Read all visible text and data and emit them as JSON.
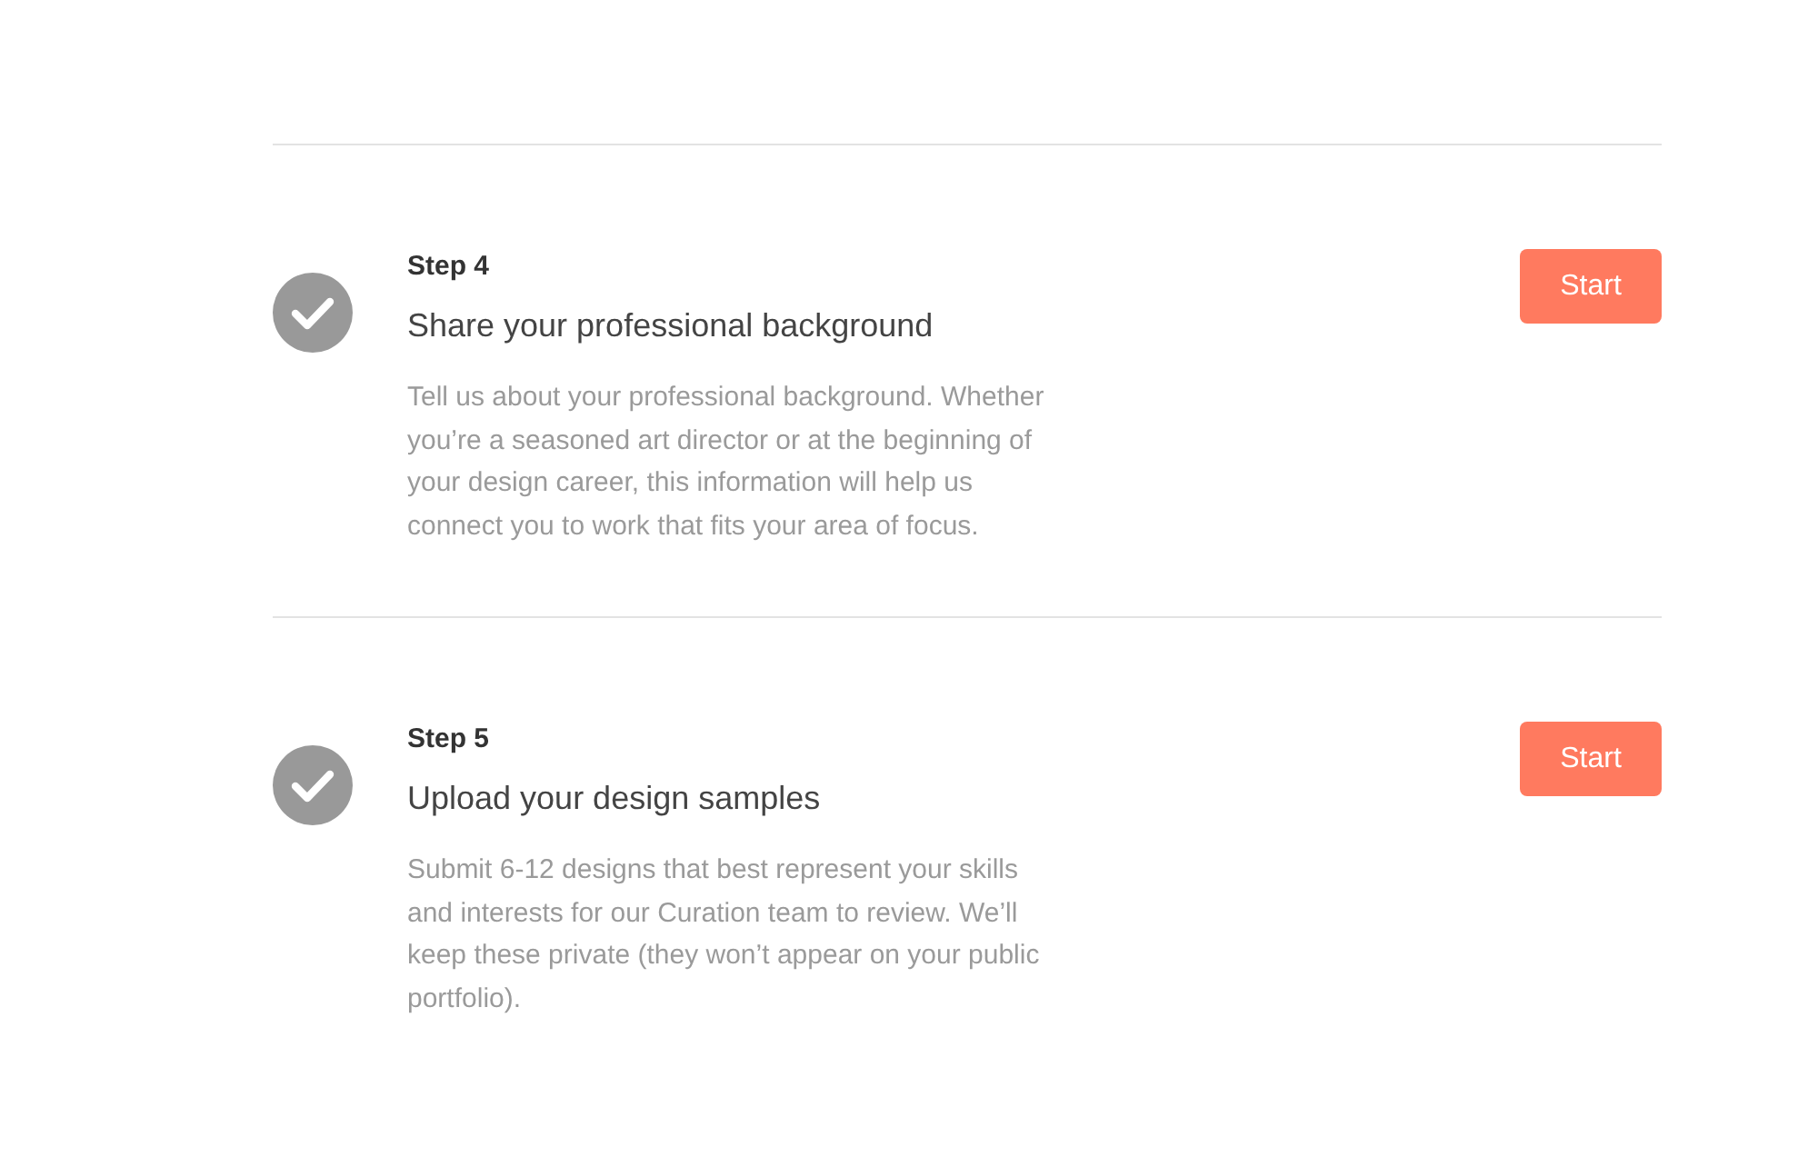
{
  "steps": [
    {
      "label": "Step 4",
      "title": "Share your professional background",
      "description": "Tell us about your professional background. Whether you’re a seasoned art director or at the beginning of your design career, this information will help us connect you to work that fits your area of focus.",
      "completed": true,
      "button": "Start"
    },
    {
      "label": "Step 5",
      "title": "Upload your design samples",
      "description": "Submit 6-12 designs that best represent your skills and interests for our Curation team to review. We’ll keep these private (they won’t appear on your public portfolio).",
      "completed": true,
      "button": "Start"
    }
  ]
}
